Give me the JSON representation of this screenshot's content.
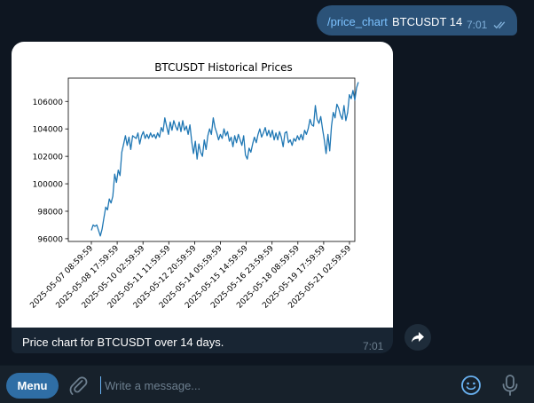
{
  "outgoing": {
    "command": "/price_chart",
    "args": "BTCUSDT 14",
    "time": "7:01",
    "status_icon": "double-check-icon"
  },
  "incoming": {
    "caption": "Price chart for BTCUSDT over 14 days.",
    "time": "7:01"
  },
  "composer": {
    "menu_label": "Menu",
    "placeholder": "Write a message...",
    "icons": [
      "paperclip-icon",
      "emoji-icon",
      "microphone-icon"
    ]
  },
  "colors": {
    "background": "#0e1621",
    "outgoing_bubble": "#2b5278",
    "incoming_bubble": "#182533",
    "accent": "#2f6ea5",
    "line": "#1f77b4"
  },
  "chart_data": {
    "type": "line",
    "title": "BTCUSDT Historical Prices",
    "xlabel": "",
    "ylabel": "",
    "ylim": [
      95800,
      107700
    ],
    "yticks": [
      96000,
      98000,
      100000,
      102000,
      104000,
      106000
    ],
    "ytick_labels": [
      "96000",
      "98000",
      "100000",
      "102000",
      "104000",
      "106000"
    ],
    "xtick_labels": [
      "2025-05-07 08:59:59",
      "2025-05-08 17:59:59",
      "2025-05-10 02:59:59",
      "2025-05-11 11:59:59",
      "2025-05-12 20:59:59",
      "2025-05-14 05:59:59",
      "2025-05-15 14:59:59",
      "2025-05-16 23:59:59",
      "2025-05-18 08:59:59",
      "2025-05-19 17:59:59",
      "2025-05-21 02:59:59"
    ],
    "x_hours_between_ticks": 33,
    "grid": false,
    "series": [
      {
        "values": [
          96600,
          97000,
          96900,
          97000,
          96600,
          96200,
          96700,
          97500,
          98300,
          98100,
          98900,
          98600,
          99100,
          100700,
          100100,
          101000,
          100600,
          102300,
          102900,
          103500,
          102800,
          103400,
          102500,
          103500,
          103400,
          103300,
          103700,
          102900,
          103500,
          103800,
          103300,
          103600,
          103300,
          103700,
          103400,
          103600,
          103300,
          103700,
          103400,
          104100,
          103800,
          104800,
          104200,
          103600,
          104500,
          103900,
          104600,
          104200,
          103900,
          104500,
          103800,
          104600,
          103900,
          104200,
          103600,
          104300,
          103100,
          102200,
          103100,
          101800,
          102900,
          102300,
          102000,
          103200,
          102500,
          103500,
          104000,
          103600,
          104800,
          104100,
          103700,
          103200,
          103600,
          103300,
          104000,
          103500,
          103800,
          103100,
          103400,
          102700,
          103500,
          103000,
          103600,
          103200,
          102800,
          103500,
          102100,
          101800,
          102600,
          102300,
          102900,
          103400,
          103000,
          103600,
          104000,
          103400,
          103700,
          104100,
          103500,
          103900,
          103400,
          103900,
          103200,
          103700,
          103200,
          103800,
          103400,
          102700,
          103700,
          103800,
          103000,
          103200,
          102800,
          103300,
          103100,
          103500,
          103200,
          103600,
          103200,
          103900,
          103600,
          104000,
          104700,
          104300,
          104200,
          105700,
          104700,
          104400,
          104900,
          104000,
          103200,
          102200,
          103600,
          102400,
          104200,
          105200,
          104800,
          105800,
          105500,
          105000,
          104700,
          105700,
          104600,
          105200,
          106500,
          106200,
          106800,
          106100,
          107000,
          107400
        ]
      }
    ]
  }
}
